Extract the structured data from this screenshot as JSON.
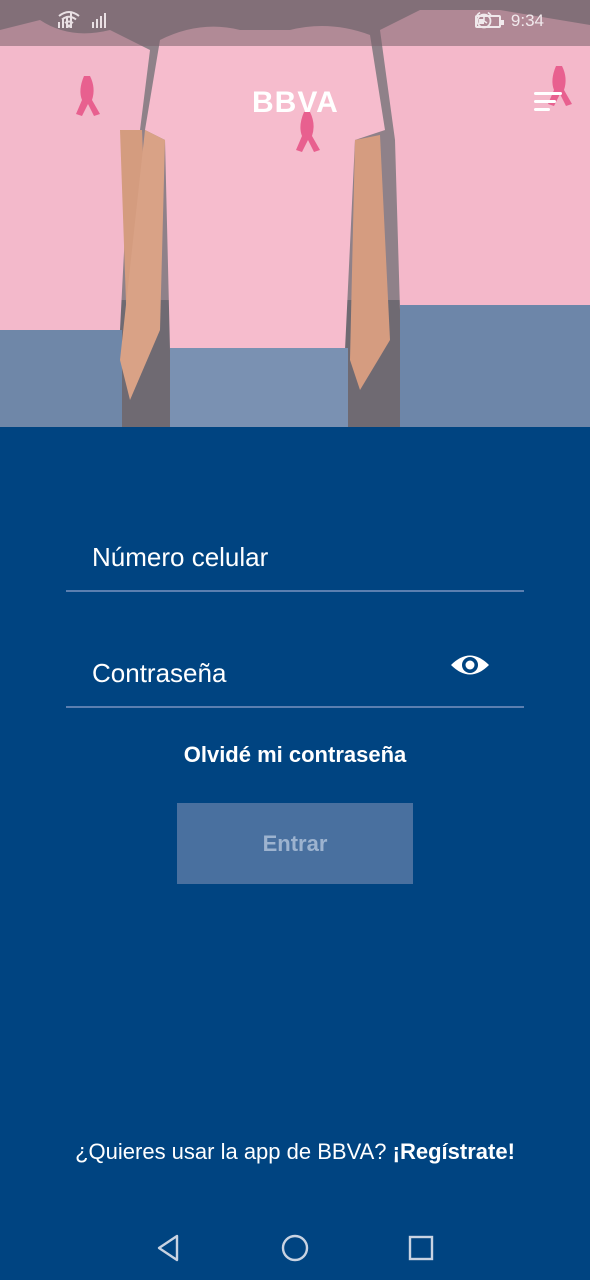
{
  "status_bar": {
    "time": "9:34",
    "battery_level": 0.3,
    "icons": [
      "signal-icon",
      "signal-icon",
      "wifi-icon",
      "alarm-icon",
      "battery-icon"
    ]
  },
  "header": {
    "logo_text": "BBVA",
    "menu_icon": "hamburger-menu-icon"
  },
  "form": {
    "phone_label": "Número celular",
    "password_label": "Contraseña",
    "password_toggle_icon": "eye-icon",
    "forgot_password": "Olvidé mi contraseña",
    "submit_label": "Entrar"
  },
  "footer": {
    "question": "¿Quieres usar la app de BBVA?",
    "register_link": "¡Regístrate!"
  },
  "nav_bar": {
    "icons": [
      "back-icon",
      "home-icon",
      "recents-icon"
    ]
  },
  "colors": {
    "primary_blue": "#004481",
    "button_disabled": "#49709f",
    "divider": "#5b7fb0"
  }
}
